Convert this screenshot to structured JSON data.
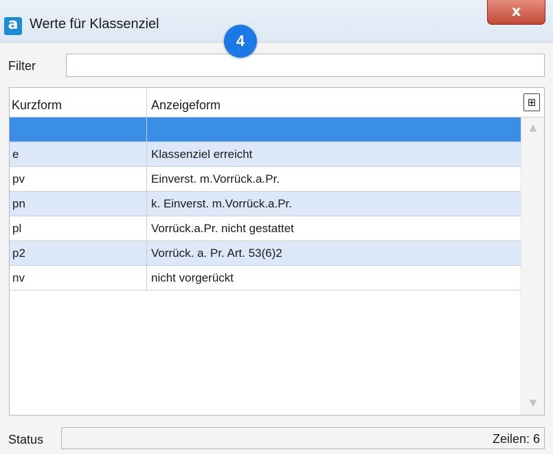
{
  "window": {
    "title": "Werte für Klassenziel",
    "app_icon_glyph": "a",
    "close_glyph": "x",
    "step_badge": "4"
  },
  "filter": {
    "label": "Filter",
    "value": "",
    "placeholder": ""
  },
  "grid": {
    "columns": [
      "Kurzform",
      "Anzeigeform"
    ],
    "column_chooser_icon": "column-chooser-icon",
    "rows": [
      {
        "kurzform": "",
        "anzeigeform": ""
      },
      {
        "kurzform": "e",
        "anzeigeform": "Klassenziel erreicht"
      },
      {
        "kurzform": "pv",
        "anzeigeform": "Einverst. m.Vorrück.a.Pr."
      },
      {
        "kurzform": "pn",
        "anzeigeform": "k. Einverst. m.Vorrück.a.Pr."
      },
      {
        "kurzform": "pl",
        "anzeigeform": "Vorrück.a.Pr. nicht gestattet"
      },
      {
        "kurzform": "p2",
        "anzeigeform": "Vorrück. a. Pr. Art. 53(6)2"
      },
      {
        "kurzform": "nv",
        "anzeigeform": "nicht vorgerückt"
      }
    ],
    "selected_row": 0
  },
  "status": {
    "label": "Status",
    "rows_text": "Zeilen: 6"
  },
  "colors": {
    "selected_row": "#3a8ee6",
    "alt_row": "#dce8f7",
    "accent": "#1b78e6",
    "close_button": "#c24a36"
  }
}
